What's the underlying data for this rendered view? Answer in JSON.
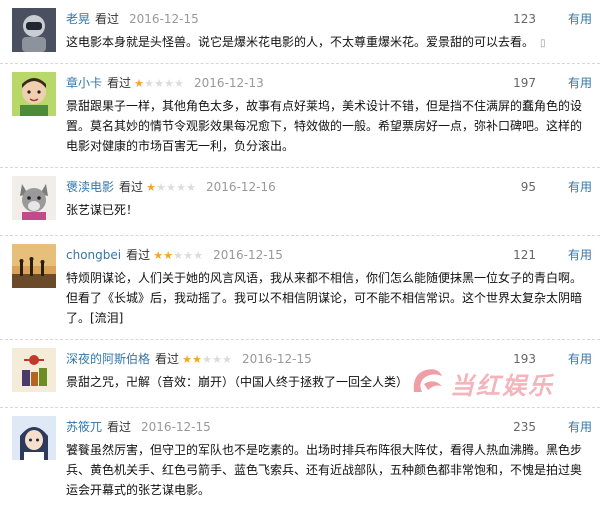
{
  "reviews": [
    {
      "user": "老晃",
      "status": "看过",
      "rating": 0,
      "date": "2016-12-15",
      "votes": "123",
      "useful": "有用",
      "avatar": "avatar-astronaut-dark",
      "text": "这电影本身就是头怪兽。说它是爆米花电影的人，不太尊重爆米花。爱景甜的可以去看。"
    },
    {
      "user": "章小卡",
      "status": "看过",
      "rating": 1,
      "date": "2016-12-13",
      "votes": "197",
      "useful": "有用",
      "avatar": "avatar-boy-green",
      "text": "景甜跟果子一样，其他角色太多，故事有点好莱坞，美术设计不错，但是挡不住满屏的蠢角色的设置。莫名其妙的情节令观影效果每况愈下，特效做的一般。希望票房好一点，弥补口碑吧。这样的电影对健康的市场百害无一利，负分滚出。"
    },
    {
      "user": "褒渎电影",
      "status": "看过",
      "rating": 1,
      "date": "2016-12-16",
      "votes": "95",
      "useful": "有用",
      "avatar": "avatar-wolf-mask",
      "text": "张艺谋已死！"
    },
    {
      "user": "chongbei",
      "status": "看过",
      "rating": 2,
      "date": "2016-12-15",
      "votes": "121",
      "useful": "有用",
      "avatar": "avatar-sunset-figures",
      "text": "特烦阴谋论，人们关于她的风言风语，我从来都不相信，你们怎么能随便抹黑一位女子的青白啊。但看了《长城》后，我动摇了。我可以不相信阴谋论，可不能不相信常识。这个世界太复杂太阴暗了。[流泪]"
    },
    {
      "user": "深夜的阿斯伯格",
      "status": "看过",
      "rating": 2,
      "date": "2016-12-15",
      "votes": "193",
      "useful": "有用",
      "avatar": "avatar-poster-art",
      "text": "景甜之咒，卍解（音效：崩开）（中国人终于拯救了一回全人类）"
    },
    {
      "user": "苏筱兀",
      "status": "看过",
      "rating": 0,
      "date": "2016-12-15",
      "votes": "235",
      "useful": "有用",
      "avatar": "avatar-anime-girl",
      "text": "饕餮虽然厉害，但守卫的军队也不是吃素的。出场时排兵布阵很大阵仗，看得人热血沸腾。黑色步兵、黄色机关手、红色弓箭手、蓝色飞索兵、还有近战部队，五种颜色都非常饱和，不愧是拍过奥运会开幕式的张艺谋电影。"
    }
  ],
  "watermark": {
    "text": "当红娱乐",
    "color": "#e0283c"
  }
}
